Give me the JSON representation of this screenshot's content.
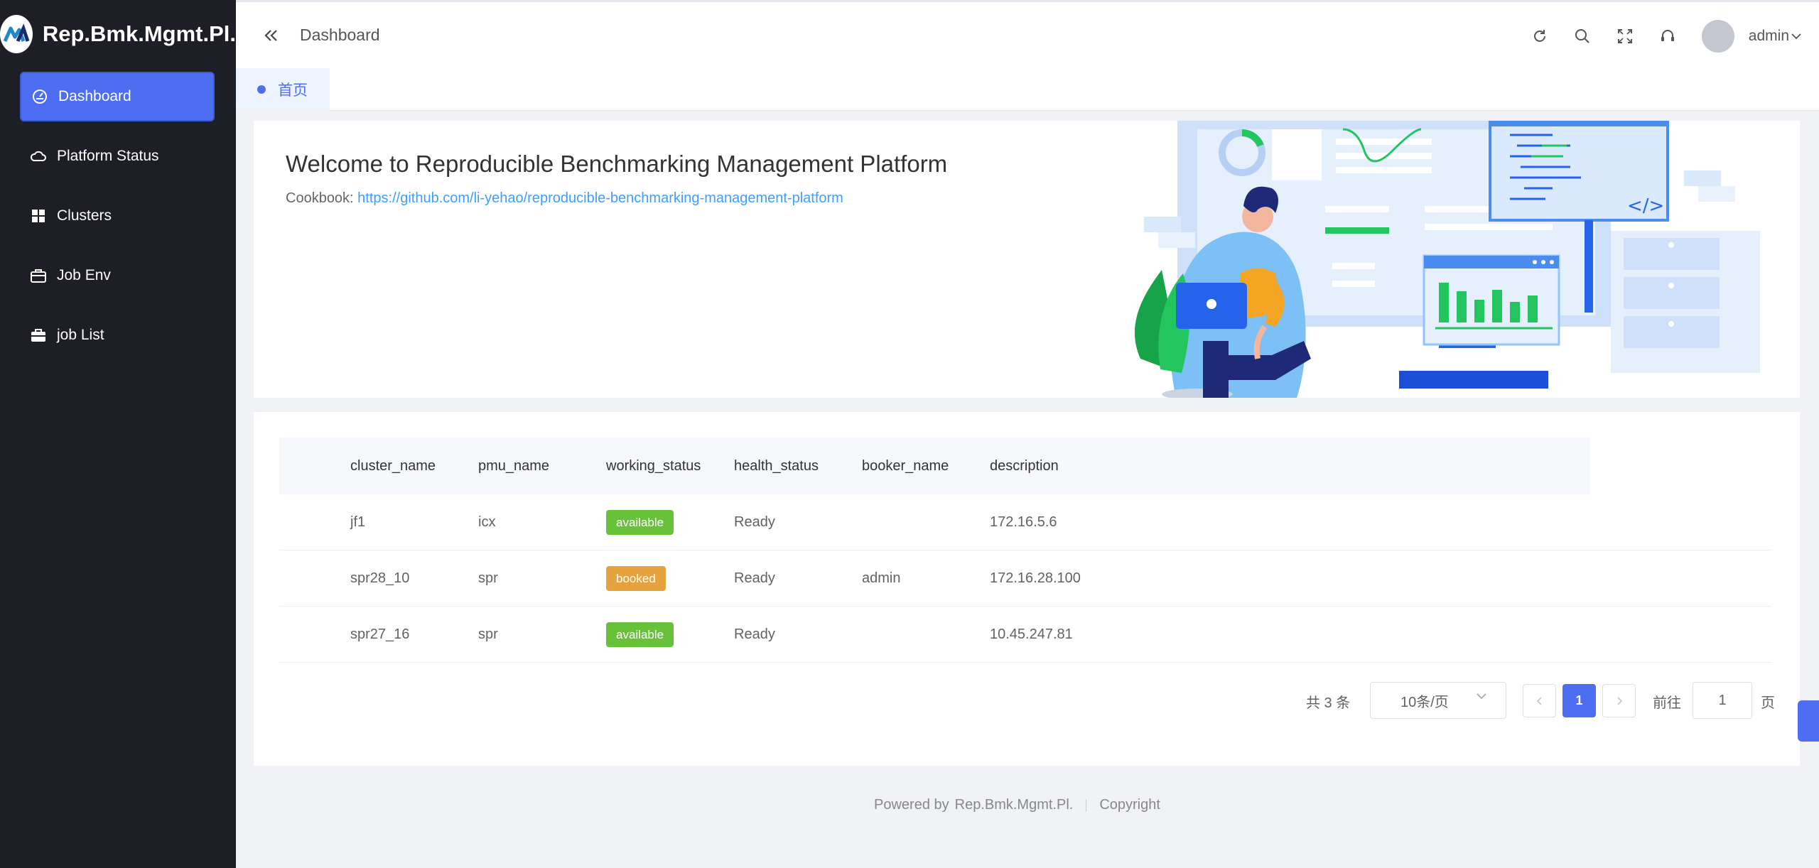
{
  "app": {
    "brand_title": "Rep.Bmk.Mgmt.Pl."
  },
  "sidebar": {
    "items": [
      {
        "label": "Dashboard",
        "icon": "dashboard-icon",
        "active": true
      },
      {
        "label": "Platform Status",
        "icon": "cloud-icon"
      },
      {
        "label": "Clusters",
        "icon": "grid-icon"
      },
      {
        "label": "Job Env",
        "icon": "briefcase-outline-icon"
      },
      {
        "label": "job List",
        "icon": "briefcase-icon"
      }
    ]
  },
  "header": {
    "breadcrumb": "Dashboard",
    "user_name": "admin"
  },
  "tabs": [
    {
      "label": "首页"
    }
  ],
  "welcome": {
    "title": "Welcome to Reproducible Benchmarking Management Platform",
    "cookbook_label": "Cookbook: ",
    "cookbook_link": "https://github.com/li-yehao/reproducible-benchmarking-management-platform"
  },
  "table": {
    "headers": [
      "cluster_name",
      "pmu_name",
      "working_status",
      "health_status",
      "booker_name",
      "description"
    ],
    "rows": [
      {
        "cluster_name": "jf1",
        "pmu_name": "icx",
        "working_status": "available",
        "health_status": "Ready",
        "booker_name": "",
        "description": "172.16.5.6"
      },
      {
        "cluster_name": "spr28_10",
        "pmu_name": "spr",
        "working_status": "booked",
        "health_status": "Ready",
        "booker_name": "admin",
        "description": "172.16.28.100"
      },
      {
        "cluster_name": "spr27_16",
        "pmu_name": "spr",
        "working_status": "available",
        "health_status": "Ready",
        "booker_name": "",
        "description": "10.45.247.81"
      }
    ]
  },
  "pagination": {
    "total_text": "共 3 条",
    "page_size": "10条/页",
    "current_page": "1",
    "goto_label": "前往",
    "goto_value": "1",
    "page_suffix": "页"
  },
  "footer": {
    "powered_by": "Powered by",
    "brand": "Rep.Bmk.Mgmt.Pl.",
    "copyright": "Copyright"
  },
  "colors": {
    "accent": "#4e6ef2",
    "sidebar_bg": "#1d1e26",
    "available": "#67c23a",
    "booked": "#e6a23c"
  }
}
